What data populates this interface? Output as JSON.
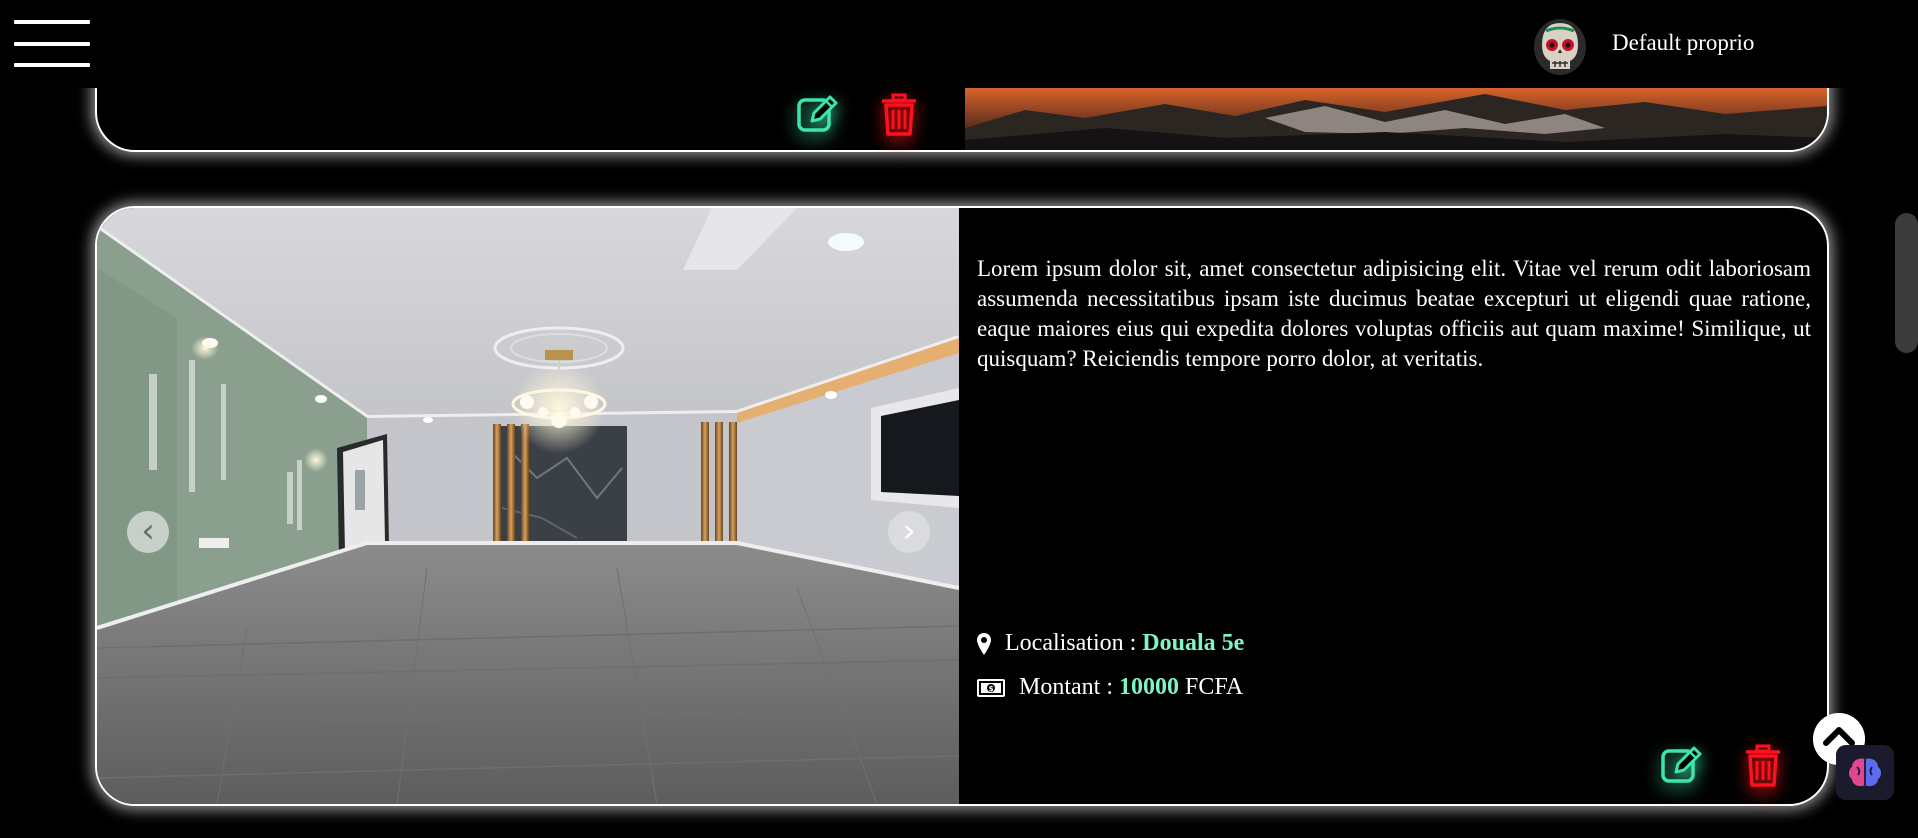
{
  "header": {
    "user_name": "Default proprio",
    "menu_icon": "hamburger-menu-icon",
    "avatar_icon": "skull-avatar"
  },
  "listings": [
    {
      "actions": {
        "edit_icon": "edit-icon",
        "delete_icon": "trash-icon"
      }
    },
    {
      "description": "Lorem ipsum dolor sit, amet consectetur adipisicing elit. Vitae vel rerum odit laboriosam assumenda necessitatibus ipsam iste ducimus beatae excepturi ut eligendi quae ratione, eaque maiores eius qui expedita dolores voluptas officiis aut quam maxime! Similique, ut quisquam? Reiciendis tempore porro dolor, at veritatis.",
      "location_label": "Localisation :",
      "location_value": "Douala 5e",
      "amount_label": "Montant :",
      "amount_value": "10000",
      "currency": "FCFA",
      "carousel": {
        "prev_icon": "chevron-left-icon",
        "next_icon": "chevron-right-icon"
      },
      "actions": {
        "edit_icon": "edit-icon",
        "delete_icon": "trash-icon"
      }
    }
  ],
  "colors": {
    "background": "#000000",
    "accent": "#7ff5c6",
    "edit": "#3ce6aa",
    "delete": "#ff0f1f",
    "card_border": "#ffffff"
  }
}
